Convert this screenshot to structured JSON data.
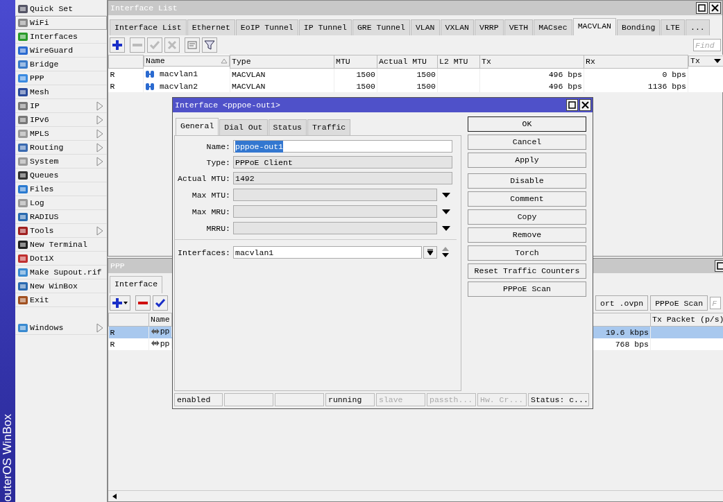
{
  "sidebar": {
    "brand": "outerOS WinBox",
    "items": [
      {
        "label": "Quick Set",
        "submenu": false,
        "selected": false
      },
      {
        "label": "WiFi",
        "submenu": false,
        "selected": true
      },
      {
        "label": "Interfaces",
        "submenu": false,
        "selected": false
      },
      {
        "label": "WireGuard",
        "submenu": false,
        "selected": false
      },
      {
        "label": "Bridge",
        "submenu": false,
        "selected": false
      },
      {
        "label": "PPP",
        "submenu": false,
        "selected": false
      },
      {
        "label": "Mesh",
        "submenu": false,
        "selected": false
      },
      {
        "label": "IP",
        "submenu": true,
        "selected": false
      },
      {
        "label": "IPv6",
        "submenu": true,
        "selected": false
      },
      {
        "label": "MPLS",
        "submenu": true,
        "selected": false
      },
      {
        "label": "Routing",
        "submenu": true,
        "selected": false
      },
      {
        "label": "System",
        "submenu": true,
        "selected": false
      },
      {
        "label": "Queues",
        "submenu": false,
        "selected": false
      },
      {
        "label": "Files",
        "submenu": false,
        "selected": false
      },
      {
        "label": "Log",
        "submenu": false,
        "selected": false
      },
      {
        "label": "RADIUS",
        "submenu": false,
        "selected": false
      },
      {
        "label": "Tools",
        "submenu": true,
        "selected": false
      },
      {
        "label": "New Terminal",
        "submenu": false,
        "selected": false
      },
      {
        "label": "Dot1X",
        "submenu": false,
        "selected": false
      },
      {
        "label": "Make Supout.rif",
        "submenu": false,
        "selected": false
      },
      {
        "label": "New WinBox",
        "submenu": false,
        "selected": false
      },
      {
        "label": "Exit",
        "submenu": false,
        "selected": false
      },
      {
        "label": "Windows",
        "submenu": true,
        "selected": false,
        "gap_before": true
      }
    ]
  },
  "interface_list": {
    "title": "Interface List",
    "active": false,
    "tabs": [
      {
        "label": "Interface List",
        "selected": false
      },
      {
        "label": "Ethernet",
        "selected": false
      },
      {
        "label": "EoIP Tunnel",
        "selected": false
      },
      {
        "label": "IP Tunnel",
        "selected": false
      },
      {
        "label": "GRE Tunnel",
        "selected": false
      },
      {
        "label": "VLAN",
        "selected": false
      },
      {
        "label": "VXLAN",
        "selected": false
      },
      {
        "label": "VRRP",
        "selected": false
      },
      {
        "label": "VETH",
        "selected": false
      },
      {
        "label": "MACsec",
        "selected": false
      },
      {
        "label": "MACVLAN",
        "selected": true
      },
      {
        "label": "Bonding",
        "selected": false
      },
      {
        "label": "LTE",
        "selected": false
      },
      {
        "label": "...",
        "selected": false
      }
    ],
    "toolbar": [
      {
        "kind": "add",
        "disabled": false
      },
      {
        "kind": "remove",
        "disabled": true
      },
      {
        "kind": "enable",
        "disabled": true
      },
      {
        "kind": "disable",
        "disabled": true
      },
      {
        "kind": "comment",
        "disabled": false
      },
      {
        "kind": "filter",
        "disabled": false
      }
    ],
    "find": {
      "placeholder": "Find"
    },
    "table": {
      "columns": [
        "",
        "Name",
        "Type",
        "MTU",
        "Actual MTU",
        "L2 MTU",
        "Tx",
        "Rx",
        "Tx"
      ],
      "rows": [
        {
          "flag": "R",
          "name": "macvlan1",
          "type": "MACVLAN",
          "mtu": "1500",
          "actual_mtu": "1500",
          "tx": "496 bps",
          "rx": "0 bps"
        },
        {
          "flag": "R",
          "name": "macvlan2",
          "type": "MACVLAN",
          "mtu": "1500",
          "actual_mtu": "1500",
          "tx": "496 bps",
          "rx": "1136 bps"
        }
      ]
    }
  },
  "ppp": {
    "title": "PPP",
    "active": false,
    "tabs": [
      {
        "label": "Interface",
        "selected": true
      }
    ],
    "toolbar": [
      {
        "kind": "add_menu",
        "disabled": false
      },
      {
        "kind": "remove",
        "disabled": false
      },
      {
        "kind": "enable",
        "disabled": false
      }
    ],
    "buttons": [
      "ort .ovpn",
      "PPPoE Scan"
    ],
    "find": {
      "placeholder": "F"
    },
    "table": {
      "columns": [
        "Name",
        "Tx Packet (p/s)"
      ],
      "rows": [
        {
          "flag": "R",
          "name": "pp",
          "rate": "19.6 kbps",
          "selected": true
        },
        {
          "flag": "R",
          "name": "pp",
          "rate": "768 bps",
          "selected": false
        }
      ]
    }
  },
  "dialog": {
    "title": "Interface <pppoe-out1>",
    "active": true,
    "tabs": [
      {
        "label": "General",
        "selected": true
      },
      {
        "label": "Dial Out",
        "selected": false
      },
      {
        "label": "Status",
        "selected": false
      },
      {
        "label": "Traffic",
        "selected": false
      }
    ],
    "fields": [
      {
        "kind": "text",
        "label": "Name:",
        "value": "pppoe-out1",
        "editable": true,
        "highlighted": true
      },
      {
        "kind": "text",
        "label": "Type:",
        "value": "PPPoE Client",
        "editable": false
      },
      {
        "kind": "text",
        "label": "Actual MTU:",
        "value": "1492",
        "editable": false
      },
      {
        "kind": "dropdown",
        "label": "Max MTU:",
        "editable": false
      },
      {
        "kind": "dropdown",
        "label": "Max MRU:",
        "editable": false
      },
      {
        "kind": "dropdown",
        "label": "MRRU:",
        "editable": false
      },
      {
        "kind": "list",
        "label": "Interfaces:",
        "value": "macvlan1",
        "editable": true
      }
    ],
    "button_groups": [
      {
        "buttons": [
          {
            "label": "OK",
            "default": true
          },
          {
            "label": "Cancel",
            "default": false
          },
          {
            "label": "Apply",
            "default": false
          }
        ]
      },
      {
        "buttons": [
          {
            "label": "Disable",
            "default": false
          },
          {
            "label": "Comment",
            "default": false
          },
          {
            "label": "Copy",
            "default": false
          },
          {
            "label": "Remove",
            "default": false
          },
          {
            "label": "Torch",
            "default": false
          },
          {
            "label": "Reset Traffic Counters",
            "default": false
          },
          {
            "label": "PPPoE Scan",
            "default": false
          }
        ]
      }
    ],
    "status_bar": [
      {
        "kind": "text",
        "text": "enabled",
        "disabled": false
      },
      {
        "kind": "blank"
      },
      {
        "kind": "blank"
      },
      {
        "kind": "text",
        "text": "running",
        "disabled": false
      },
      {
        "kind": "text",
        "text": "slave",
        "disabled": true
      },
      {
        "kind": "text",
        "text": "passth...",
        "disabled": true
      },
      {
        "kind": "text",
        "text": "Hw. Cr...",
        "disabled": true
      },
      {
        "kind": "text",
        "text": "Status: c...",
        "disabled": false
      }
    ]
  }
}
